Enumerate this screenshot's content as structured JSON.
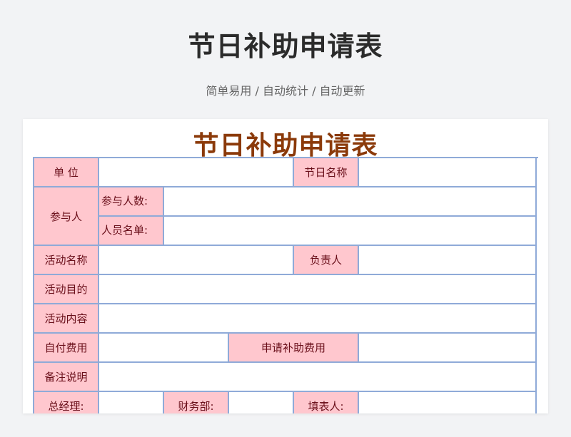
{
  "page": {
    "title": "节日补助申请表",
    "subtitle": "简单易用 / 自动统计 / 自动更新"
  },
  "form": {
    "title": "节日补助申请表",
    "labels": {
      "unit": "单 位",
      "holiday_name": "节日名称",
      "participants": "参与人",
      "participant_count": "参与人数:",
      "participant_list": "人员名单:",
      "activity_name": "活动名称",
      "person_in_charge": "负责人",
      "activity_purpose": "活动目的",
      "activity_content": "活动内容",
      "self_paid_cost": "自付费用",
      "requested_subsidy": "申请补助费用",
      "remarks": "备注说明",
      "general_manager": "总经理:",
      "finance_dept": "财务部:",
      "filled_by": "填表人:"
    }
  }
}
